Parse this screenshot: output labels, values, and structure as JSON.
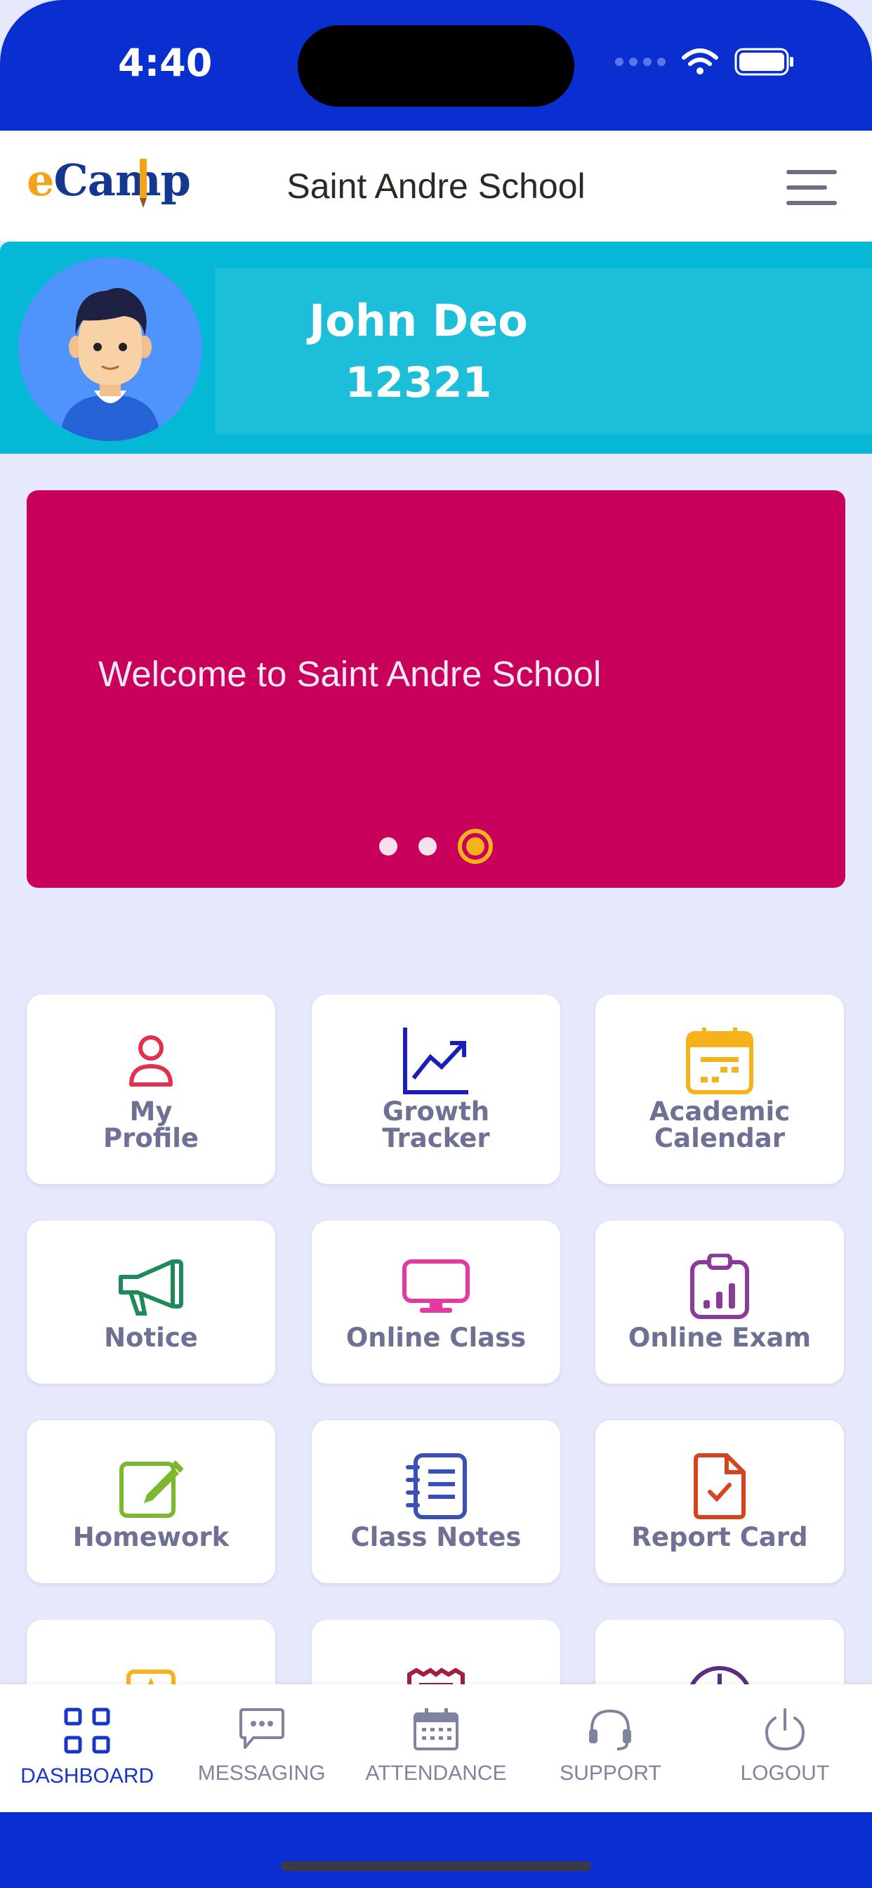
{
  "status": {
    "time": "4:40"
  },
  "header": {
    "logo_e": "e",
    "logo_rest": "Camp",
    "school_name": "Saint Andre School"
  },
  "profile": {
    "name": "John Deo",
    "id": "12321"
  },
  "banner": {
    "text": "Welcome to Saint Andre School",
    "slides": 3,
    "active_slide": 3,
    "color": "#c8005c"
  },
  "tiles": [
    {
      "label": "My\nProfile",
      "icon": "user-icon",
      "color": "#e0314f"
    },
    {
      "label": "Growth\nTracker",
      "icon": "growth-chart-icon",
      "color": "#1a1fb8"
    },
    {
      "label": "Academic\nCalendar",
      "icon": "calendar-icon",
      "color": "#f6b21a"
    },
    {
      "label": "Notice",
      "icon": "megaphone-icon",
      "color": "#1e8a5a"
    },
    {
      "label": "Online Class",
      "icon": "monitor-icon",
      "color": "#e23aa0"
    },
    {
      "label": "Online Exam",
      "icon": "clipboard-chart-icon",
      "color": "#8a3b9a"
    },
    {
      "label": "Homework",
      "icon": "edit-icon",
      "color": "#7bb82e"
    },
    {
      "label": "Class Notes",
      "icon": "notes-icon",
      "color": "#3b4fb8"
    },
    {
      "label": "Report Card",
      "icon": "report-card-icon",
      "color": "#d4451f"
    }
  ],
  "bottom_nav": [
    {
      "label": "DASHBOARD",
      "icon": "dashboard-icon",
      "active": true
    },
    {
      "label": "MESSAGING",
      "icon": "message-icon",
      "active": false
    },
    {
      "label": "ATTENDANCE",
      "icon": "attendance-icon",
      "active": false
    },
    {
      "label": "SUPPORT",
      "icon": "headset-icon",
      "active": false
    },
    {
      "label": "LOGOUT",
      "icon": "power-icon",
      "active": false
    }
  ],
  "colors": {
    "status_bar": "#0a2fd1",
    "profile_band": "#04b8d6",
    "nav_active": "#1836c9",
    "page_bg": "#e6e8fb"
  }
}
